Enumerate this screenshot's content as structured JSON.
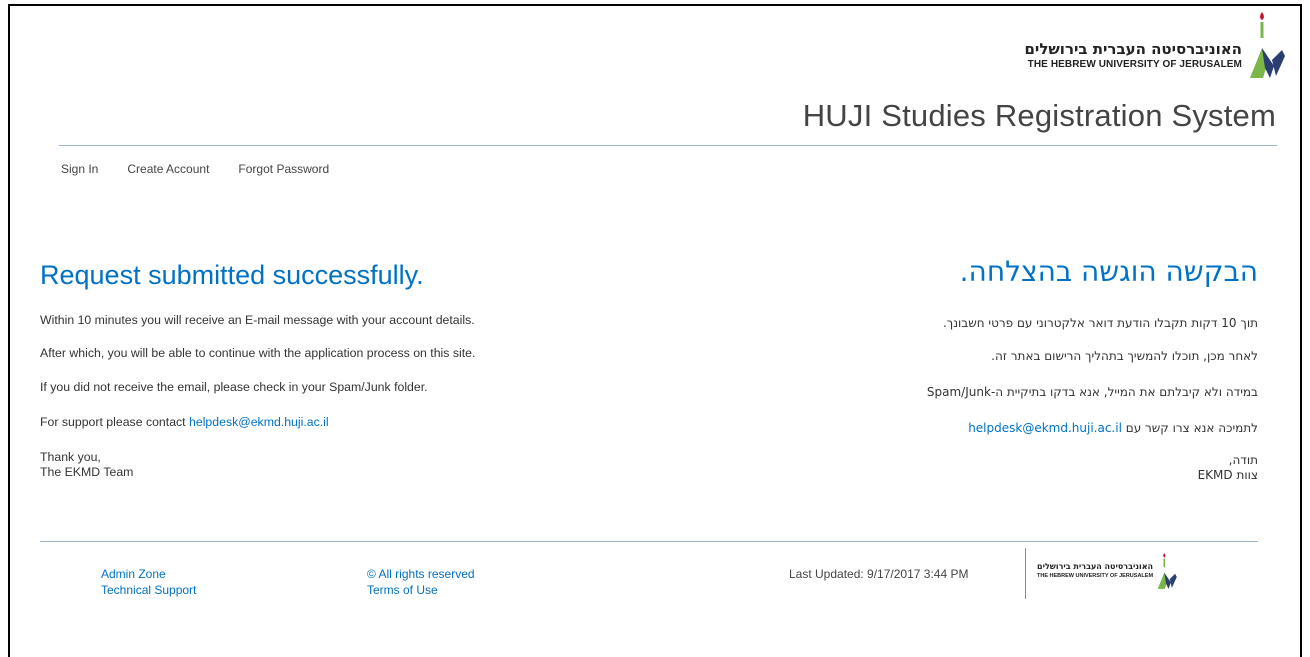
{
  "header": {
    "logo_hebrew": "האוניברסיטה העברית בירושלים",
    "logo_english": "THE HEBREW UNIVERSITY OF JERUSALEM",
    "site_title": "HUJI Studies Registration System"
  },
  "nav": {
    "items": [
      "Sign In",
      "Create Account",
      "Forgot Password"
    ]
  },
  "english": {
    "heading": "Request submitted successfully.",
    "line1": "Within 10 minutes you will receive an E-mail message with your account details.",
    "line2": "After which, you will be able to continue with the application process on this site.",
    "line3": "If you did not receive the email, please check in your Spam/Junk folder.",
    "line4_prefix": "For support please contact ",
    "support_email": "helpdesk@ekmd.huji.ac.il",
    "thanks": "Thank you,",
    "signature": "The EKMD Team"
  },
  "hebrew": {
    "heading": "הבקשה הוגשה בהצלחה.",
    "line1": "תוך 10 דקות תקבלו הודעת דואר אלקטרוני עם פרטי חשבונך.",
    "line2": "לאחר מכן, תוכלו להמשיך בתהליך הרישום באתר זה.",
    "line3": "במידה ולא קיבלתם את המייל, אנא בדקו בתיקיית ה-Spam/Junk",
    "line4_prefix": "לתמיכה אנא צרו קשר עם ",
    "support_email": "helpdesk@ekmd.huji.ac.il",
    "thanks": "תודה,",
    "signature": "צוות EKMD"
  },
  "footer": {
    "admin_zone": "Admin Zone",
    "technical_support": "Technical Support",
    "rights": "© All rights reserved",
    "terms": "Terms of Use",
    "last_updated": "Last Updated: 9/17/2017 3:44 PM",
    "logo_hebrew": "האוניברסיטה העברית בירושלים",
    "logo_english": "THE HEBREW UNIVERSITY OF JERUSALEM"
  },
  "colors": {
    "accent": "#0072c6",
    "divider": "#9fb7cc",
    "logo_red": "#c8102e",
    "logo_green": "#7ab648",
    "logo_navy": "#2b3e72"
  },
  "icons": {
    "header_logo": "huji-logo-icon",
    "footer_logo": "huji-logo-icon"
  }
}
